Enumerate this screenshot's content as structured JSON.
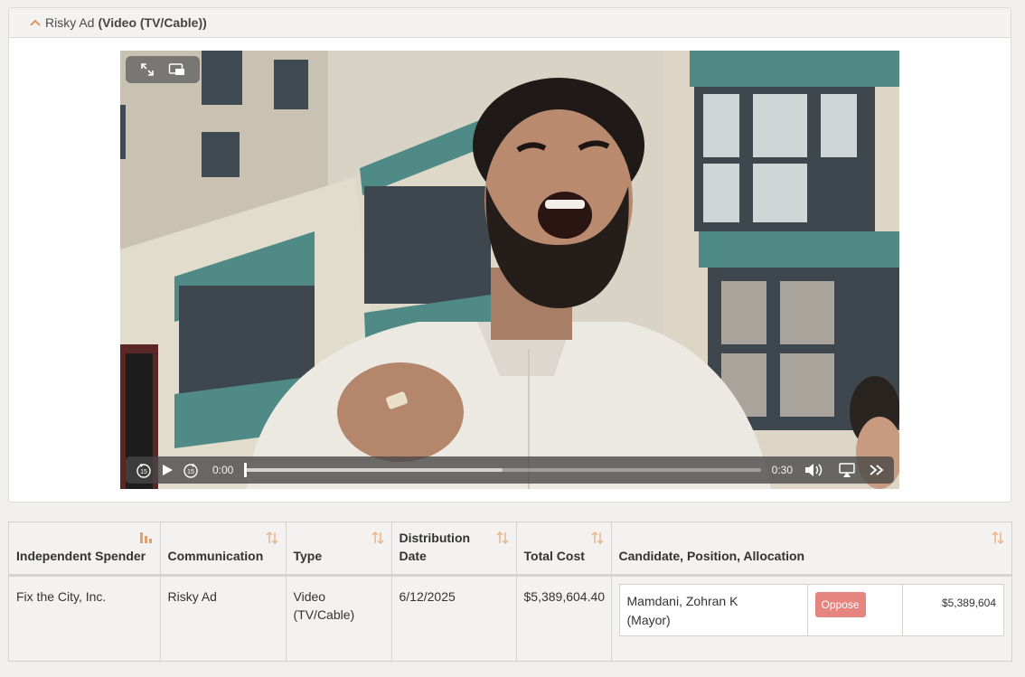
{
  "panel": {
    "ad_name": "Risky Ad",
    "ad_type": "(Video (TV/Cable))"
  },
  "video": {
    "current_time": "0:00",
    "duration": "0:30",
    "progress": 0.0,
    "buffered": 0.5,
    "icons": {
      "expand": "expand-icon",
      "pip": "picture-in-picture-icon",
      "rewind": "rewind-15-icon",
      "play": "play-icon",
      "forward": "forward-15-icon",
      "volume": "volume-icon",
      "airplay": "airplay-icon",
      "speed": "playback-speed-icon"
    },
    "rewind_label": "15",
    "forward_label": "15"
  },
  "table": {
    "headers": {
      "spender": "Independent Spender",
      "communication": "Communication",
      "type": "Type",
      "date": "Distribution Date",
      "cost": "Total Cost",
      "candidate": "Candidate, Position, Allocation"
    },
    "row": {
      "spender": "Fix the City, Inc.",
      "communication": "Risky Ad",
      "type": "Video (TV/Cable)",
      "date": "6/12/2025",
      "cost": "$5,389,604.40",
      "candidate_name": "Mamdani, Zohran K",
      "candidate_office": "(Mayor)",
      "position": "Oppose",
      "allocation": "$5,389,604"
    }
  },
  "colors": {
    "accent": "#e0894d",
    "oppose": "#e58580"
  }
}
